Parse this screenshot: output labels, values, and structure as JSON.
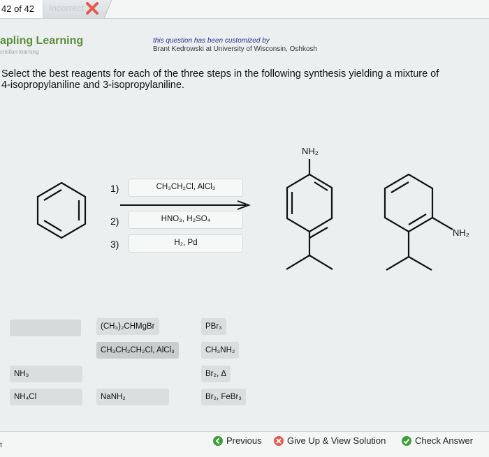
{
  "header": {
    "question_counter": "42 of 42",
    "status": "Incorrect"
  },
  "brand": {
    "name": "apling Learning",
    "sub": "cmillan learning"
  },
  "credit": {
    "line1": "this question has been customized by",
    "line2": "Brant Kedrowski at University of Wisconsin, Oshkosh"
  },
  "question": {
    "line1": "Select the best reagents for each of the three steps in the following synthesis yielding a mixture of",
    "line2": "4-isopropylaniline and 3-isopropylaniline."
  },
  "steps": [
    {
      "number": "1)",
      "reagent": "CH₃CH₂Cl, AlCl₃"
    },
    {
      "number": "2)",
      "reagent": "HNO₃, H₂SO₄"
    },
    {
      "number": "3)",
      "reagent": "H₂, Pd"
    }
  ],
  "product_labels": {
    "para": "NH₂",
    "meta": "NH₂"
  },
  "reagent_bank": [
    "(CH₃)₂CHMgBr",
    "PBr₃",
    "CH₃CH₂CH₂Cl, AlCl₃",
    "CH₃NH₂",
    "NH₃",
    "Br₂, Δ",
    "NH₄Cl",
    "NaNH₂",
    "Br₂, FeBr₃"
  ],
  "footer": {
    "left": "t",
    "previous": "Previous",
    "give_up": "Give Up & View Solution",
    "check": "Check Answer"
  },
  "colors": {
    "brand_green": "#5b8e3b",
    "incorrect_red": "#e25b4c",
    "check_green": "#3f9d3a"
  }
}
